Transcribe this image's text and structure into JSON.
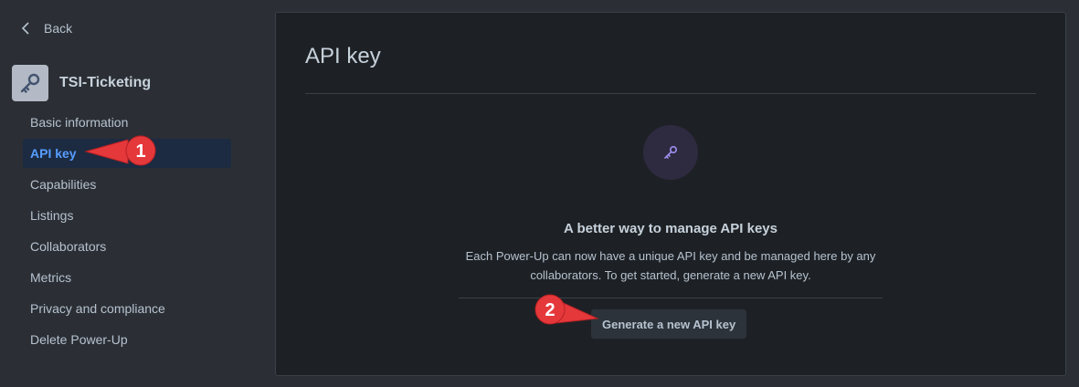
{
  "sidebar": {
    "back_label": "Back",
    "app_name": "TSI-Ticketing",
    "items": [
      {
        "label": "Basic information"
      },
      {
        "label": "API key"
      },
      {
        "label": "Capabilities"
      },
      {
        "label": "Listings"
      },
      {
        "label": "Collaborators"
      },
      {
        "label": "Metrics"
      },
      {
        "label": "Privacy and compliance"
      },
      {
        "label": "Delete Power-Up"
      }
    ],
    "active_index": 1
  },
  "main": {
    "title": "API key",
    "empty_title": "A better way to manage API keys",
    "empty_description": "Each Power-Up can now have a unique API key and be managed here by any collaborators. To get started, generate a new API key.",
    "generate_button": "Generate a new API key"
  },
  "annotations": [
    {
      "number": "1"
    },
    {
      "number": "2"
    }
  ],
  "colors": {
    "accent": "#579dff",
    "callout": "#e5383b",
    "key_icon": "#9f8fef"
  },
  "icons": {
    "back": "chevron-left-icon",
    "app": "key-icon",
    "empty_state": "key-icon"
  }
}
